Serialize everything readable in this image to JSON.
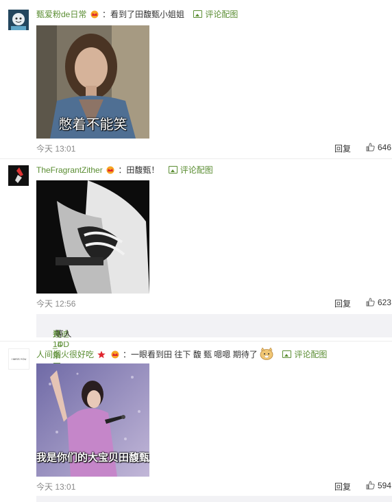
{
  "comments": [
    {
      "username": "甄爱粉de日常",
      "text": "：看到了田馥甄小姐姐",
      "pic_link": "评论配图",
      "image_caption": "憋着不能笑",
      "time": "今天 13:01",
      "reply": "回复",
      "likes": "646"
    },
    {
      "username": "TheFragrantZither",
      "text": "：田馥甄！",
      "pic_link": "评论配图",
      "time": "今天 12:56",
      "reply": "回复",
      "likes": "623",
      "more_replies": {
        "user": "迪迪_DD",
        "middle": " 等人 ",
        "count": "共14条回复"
      }
    },
    {
      "username": "人间烟火很好吃",
      "text": "：一眼看到田 往下 馥 甄 嗯嗯 期待了",
      "pic_link": "评论配图",
      "image_caption": "我是你们的大宝贝田馥甄",
      "avatar_text": "I MISS YOU",
      "time": "今天 13:01",
      "reply": "回复",
      "likes": "594"
    }
  ],
  "colors": {
    "username": "#5a8d32",
    "time": "#888888",
    "more_box_bg": "#f2f2f5"
  },
  "icons": [
    "vip-crown-icon",
    "picture-icon",
    "thumbs-up-icon",
    "star-icon",
    "doge-emoji-icon"
  ]
}
